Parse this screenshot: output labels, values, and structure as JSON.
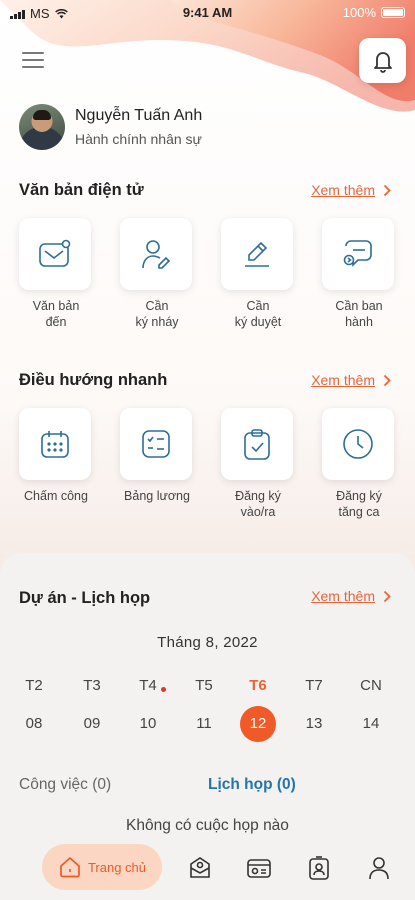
{
  "status_bar": {
    "carrier": "MS",
    "time": "9:41 AM",
    "battery": "100%"
  },
  "header": {
    "menu_icon": "hamburger-menu-icon",
    "notification_icon": "bell-icon"
  },
  "profile": {
    "name": "Nguyễn Tuấn Anh",
    "role": "Hành chính nhân sự"
  },
  "documents": {
    "title": "Văn bản điện tử",
    "see_more": "Xem thêm",
    "items": [
      {
        "label": "Văn bản\nđến",
        "icon": "inbox-mail-icon"
      },
      {
        "label": "Cần\nký nháy",
        "icon": "user-edit-icon"
      },
      {
        "label": "Cần\nký duyệt",
        "icon": "pen-sign-icon"
      },
      {
        "label": "Cần ban\nhành",
        "icon": "chat-publish-icon"
      }
    ]
  },
  "quick_nav": {
    "title": "Điều hướng nhanh",
    "see_more": "Xem thêm",
    "items": [
      {
        "label": "Chấm công",
        "icon": "calendar-icon"
      },
      {
        "label": "Bảng lương",
        "icon": "checklist-icon"
      },
      {
        "label": "Đăng ký\nvào/ra",
        "icon": "clipboard-check-icon"
      },
      {
        "label": "Đăng ký\ntăng ca",
        "icon": "clock-icon"
      }
    ]
  },
  "schedule": {
    "title": "Dự án - Lịch họp",
    "see_more": "Xem thêm",
    "month": "Tháng 8, 2022",
    "days": [
      "T2",
      "T3",
      "T4",
      "T5",
      "T6",
      "T7",
      "CN"
    ],
    "dates": [
      "08",
      "09",
      "10",
      "11",
      "12",
      "13",
      "14"
    ],
    "selected_index": 4,
    "event_dot_index": 2,
    "tabs": {
      "tasks": "Công việc (0)",
      "meetings": "Lịch họp (0)"
    },
    "active_tab": "meetings",
    "empty_message": "Không có cuộc họp nào"
  },
  "bottom_nav": {
    "home_label": "Trang chủ",
    "items": [
      "home-icon",
      "mail-user-icon",
      "id-card-icon",
      "contact-badge-icon",
      "profile-icon"
    ]
  },
  "colors": {
    "accent": "#ef5a28",
    "link_blue": "#2475a8",
    "accent_text": "#e8653a"
  }
}
